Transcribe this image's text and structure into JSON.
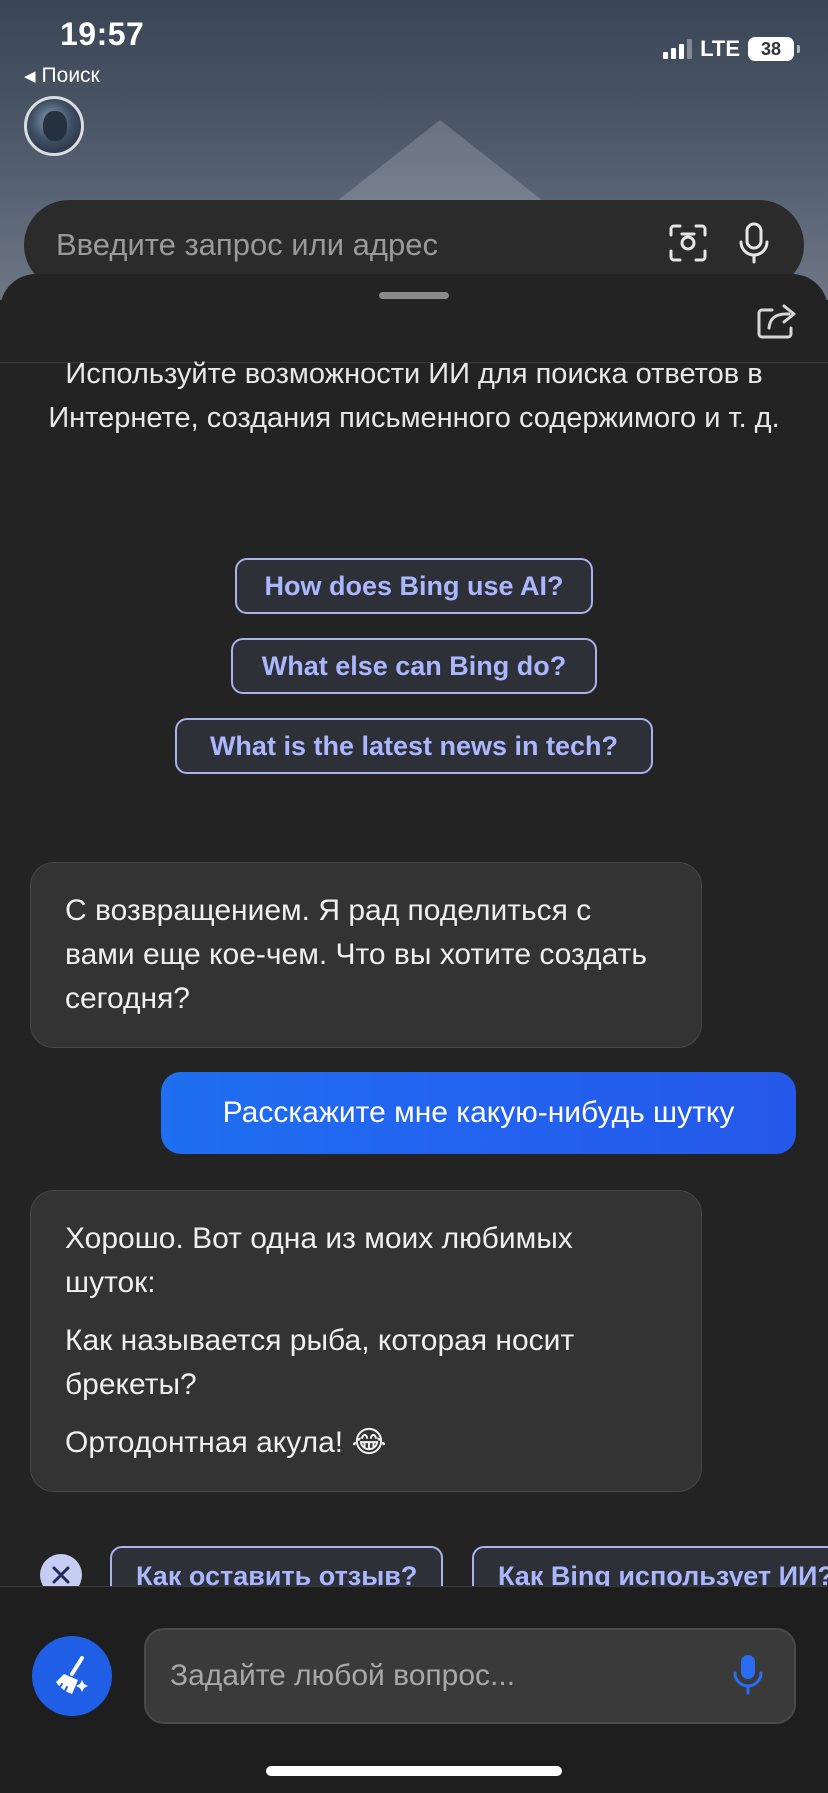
{
  "status_bar": {
    "time": "19:57",
    "back_label": "Поиск",
    "network": "LTE",
    "battery": "38"
  },
  "search": {
    "placeholder": "Введите запрос или адрес",
    "icons": [
      "visual-search-icon",
      "microphone-icon"
    ]
  },
  "intro_text": "Используйте возможности ИИ для поиска ответов в Интернете, создания письменного содержимого и т. д.",
  "suggestions": [
    "How does Bing use AI?",
    "What else can Bing do?",
    "What is the latest news in tech?"
  ],
  "messages": {
    "bot_welcome": "С возвращением. Я рад поделиться с вами еще кое-чем. Что вы хотите создать сегодня?",
    "user_request": "Расскажите мне какую-нибудь шутку",
    "bot_joke": {
      "line1": "Хорошо. Вот одна из моих любимых шуток:",
      "line2": "Как называется рыба, которая носит брекеты?",
      "line3": "Ортодонтная акула! 😂"
    }
  },
  "followup_suggestions": [
    "Как оставить отзыв?",
    "Как Bing использует ИИ?"
  ],
  "composer": {
    "placeholder": "Задайте любой вопрос..."
  },
  "colors": {
    "accent": "#1f5fe6",
    "chip_text": "#aab7ff",
    "panel_bg": "#232323"
  }
}
